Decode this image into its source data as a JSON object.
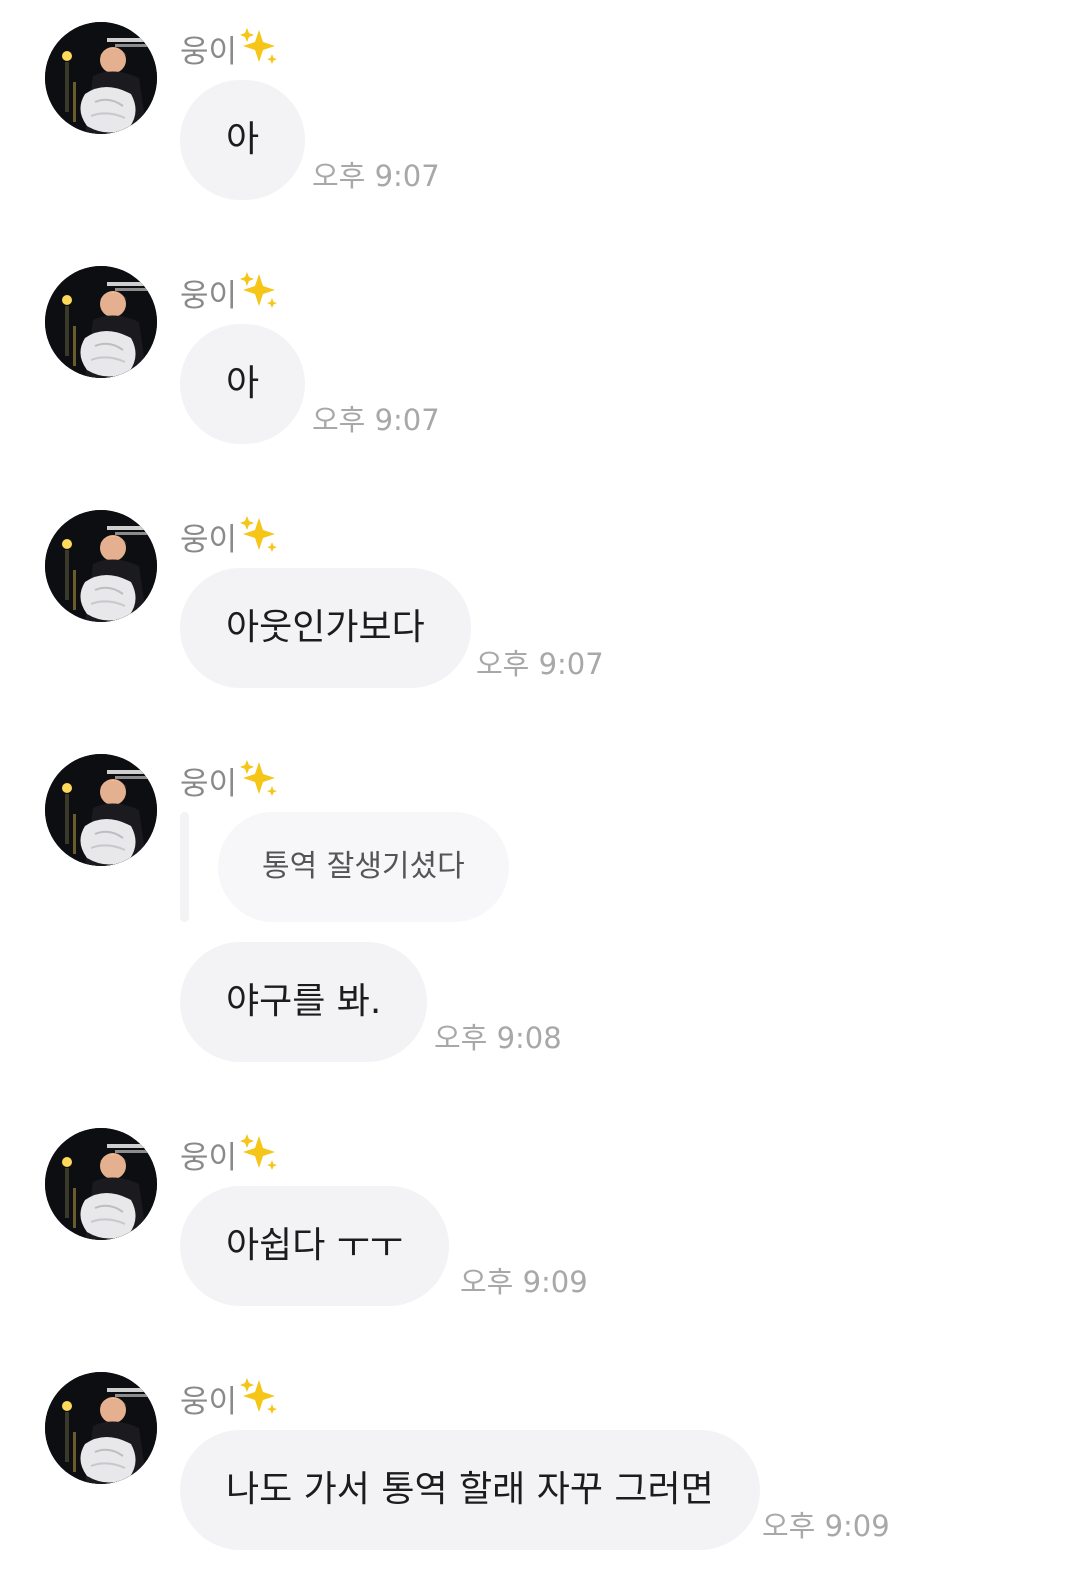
{
  "sender_name": "웅이",
  "sender_emoji": "sparkles-icon",
  "messages": [
    {
      "text": "아",
      "time": "오후 9:07"
    },
    {
      "text": "아",
      "time": "오후 9:07"
    },
    {
      "text": "아웃인가보다",
      "time": "오후 9:07"
    },
    {
      "reply_to": "통역 잘생기셨다",
      "text": "야구를 봐.",
      "time": "오후 9:08"
    },
    {
      "text": "아쉽다 ㅜㅜ",
      "time": "오후 9:09"
    },
    {
      "text": "나도 가서 통역 할래 자꾸 그러면",
      "time": "오후 9:09"
    }
  ],
  "colors": {
    "bubble": "#f3f3f6",
    "reply_bubble": "#f7f7f9",
    "timestamp": "#a8a8a8",
    "sender": "#8a8a8a"
  }
}
